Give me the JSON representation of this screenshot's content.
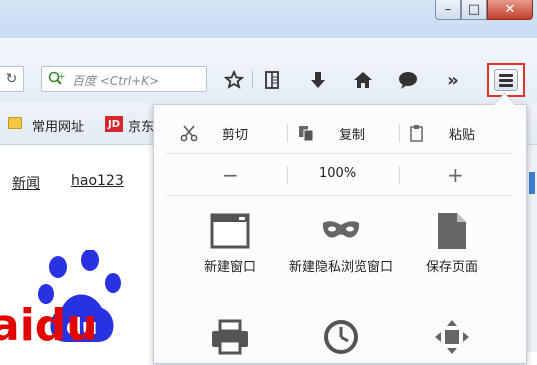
{
  "toolbar": {
    "search_placeholder": "百度 <Ctrl+K>",
    "reload_icon": "reload-icon",
    "icons": [
      "bookmark-star-icon",
      "reading-list-icon",
      "download-icon",
      "home-icon",
      "chat-icon",
      "overflow-chevrons-icon"
    ],
    "overflow_label": "»"
  },
  "window": {
    "minimize": "–",
    "maximize": "□",
    "close": "✕"
  },
  "bookmarks": {
    "items": [
      {
        "label": "常用网址",
        "icon": "folder-icon"
      },
      {
        "label": "京东",
        "icon": "jd-icon",
        "badge": "JD"
      }
    ]
  },
  "page": {
    "links": [
      "新闻",
      "hao123"
    ],
    "logo_text": "aidu",
    "logo_badge": "du"
  },
  "menu": {
    "edit_row": [
      {
        "label": "剪切",
        "icon": "scissors-icon"
      },
      {
        "label": "复制",
        "icon": "copy-icon"
      },
      {
        "label": "粘贴",
        "icon": "paste-icon"
      }
    ],
    "zoom": {
      "minus": "−",
      "value": "100%",
      "plus": "+"
    },
    "items": [
      {
        "label": "新建窗口",
        "icon": "new-window-icon"
      },
      {
        "label": "新建隐私浏览窗口",
        "icon": "private-mask-icon"
      },
      {
        "label": "保存页面",
        "icon": "save-page-icon"
      },
      {
        "label": "",
        "icon": "print-icon"
      },
      {
        "label": "",
        "icon": "history-clock-icon"
      },
      {
        "label": "",
        "icon": "fullscreen-icon"
      }
    ]
  },
  "colors": {
    "highlight_border": "#e0312b",
    "baidu_red": "#e10601",
    "baidu_blue": "#2932e1"
  }
}
